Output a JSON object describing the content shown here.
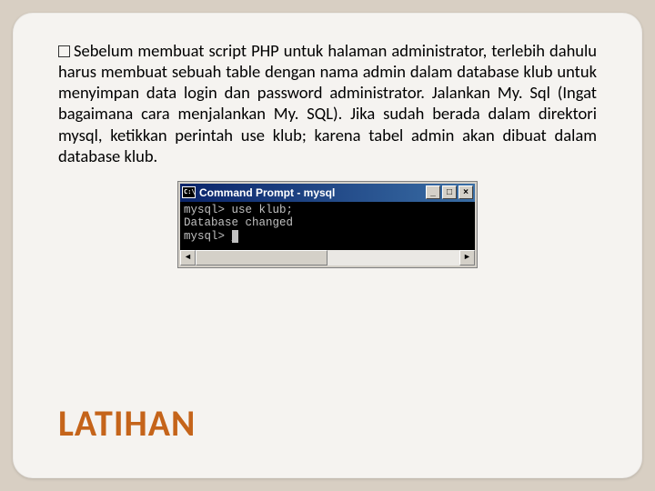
{
  "paragraph": "Sebelum membuat script PHP untuk halaman administrator, terlebih dahulu harus membuat sebuah table dengan nama admin dalam database klub untuk menyimpan data login dan password administrator. Jalankan My. Sql (Ingat bagaimana cara menjalankan My. SQL). Jika sudah berada dalam direktori mysql, ketikkan perintah use klub; karena tabel admin akan dibuat dalam database klub.",
  "terminal": {
    "title": "Command Prompt - mysql",
    "line1": "mysql> use klub;",
    "line2": "Database changed",
    "line3": "mysql> "
  },
  "heading": "LATIHAN",
  "buttons": {
    "min": "_",
    "max": "□",
    "close": "×"
  },
  "scroll": {
    "left": "◄",
    "right": "►"
  }
}
